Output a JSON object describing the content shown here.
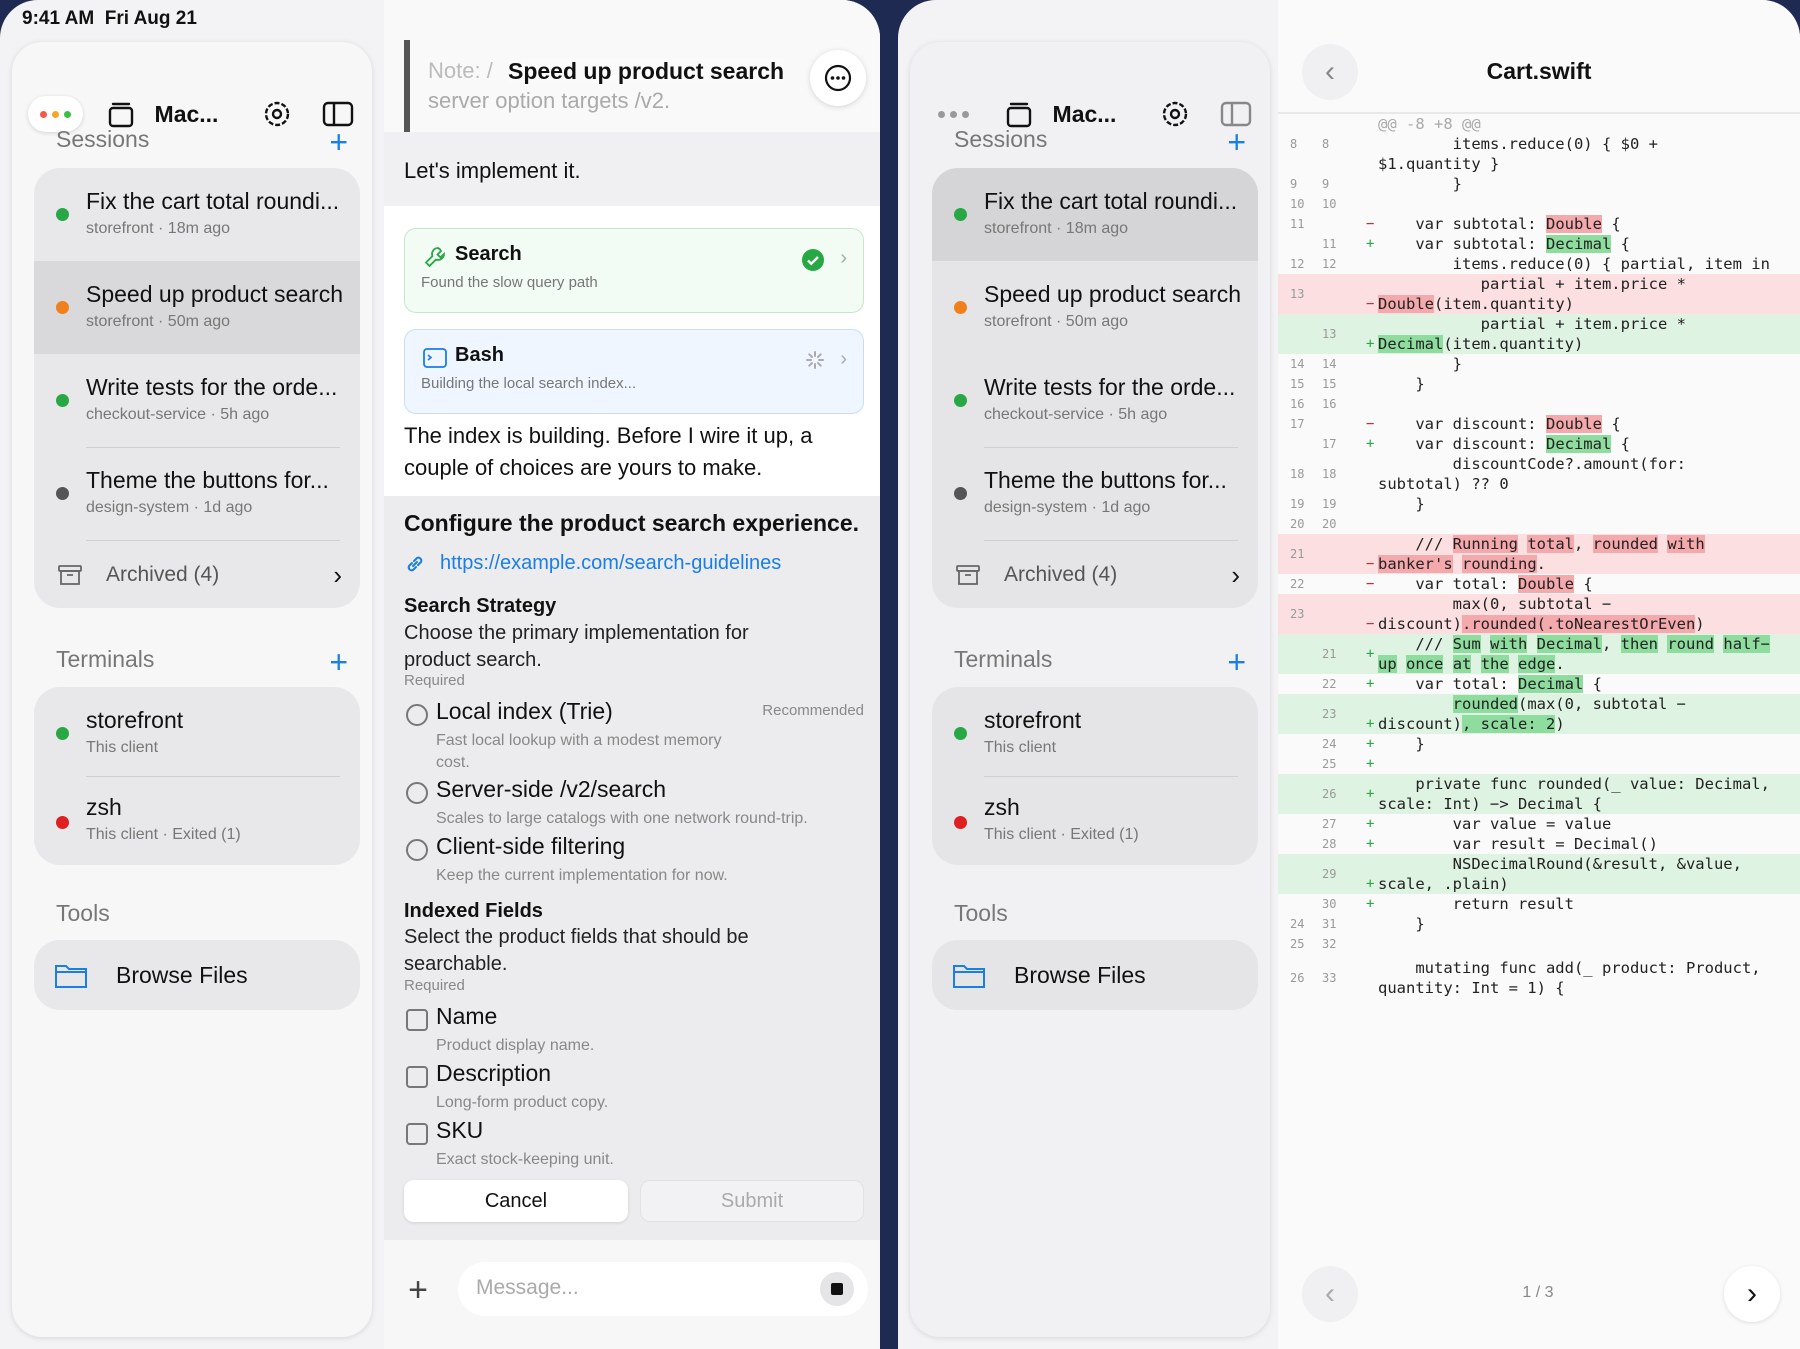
{
  "status": {
    "time": "9:41 AM",
    "date": "Fri Aug 21"
  },
  "colors": {
    "accent": "#1a7ee8",
    "green": "#28a745",
    "orange": "#f0801c",
    "red": "#e02020",
    "gray": "#555555",
    "removed": "#fce0e1",
    "added": "#dff3e3"
  },
  "sidebar": {
    "title": "Mac...",
    "sessions_label": "Sessions",
    "sessions": [
      {
        "title": "Fix the cart total roundi...",
        "sub": "storefront · 18m ago"
      },
      {
        "title": "Speed up product search",
        "sub": "storefront · 50m ago"
      },
      {
        "title": "Write tests for the orde...",
        "sub": "checkout-service · 5h ago"
      },
      {
        "title": "Theme the buttons for...",
        "sub": "design-system · 1d ago"
      }
    ],
    "archived": "Archived (4)",
    "terminals_label": "Terminals",
    "terminals": [
      {
        "title": "storefront",
        "sub": "This client"
      },
      {
        "title": "zsh",
        "sub": "This client · Exited (1)"
      }
    ],
    "tools_label": "Tools",
    "browse_files": "Browse Files"
  },
  "chat": {
    "title": "Speed up product search",
    "bg_note": "Note: / ... server option targets /v2.",
    "bg_note1": "Note: /",
    "bg_note2": "server option targets /v2.",
    "user_msg": "Let's implement it.",
    "tools": [
      {
        "name": "Search",
        "desc": "Found the slow query path"
      },
      {
        "name": "Bash",
        "desc": "Building the local search index..."
      }
    ],
    "assistant_msg": "The index is building. Before I wire it up, a couple of choices are yours to make.",
    "form": {
      "heading": "Configure the product search experience.",
      "link": "https://example.com/search-guidelines",
      "q1_label": "Search Strategy",
      "q1_desc": "Choose the primary implementation for product search.",
      "q1_required": "Required",
      "q1_options": [
        {
          "name": "Local index (Trie)",
          "desc": "Fast local lookup with a modest memory cost.",
          "badge": "Recommended"
        },
        {
          "name": "Server-side /v2/search",
          "desc": "Scales to large catalogs with one network round-trip."
        },
        {
          "name": "Client-side filtering",
          "desc": "Keep the current implementation for now."
        }
      ],
      "q2_label": "Indexed Fields",
      "q2_desc": "Select the product fields that should be searchable.",
      "q2_required": "Required",
      "q2_options": [
        {
          "name": "Name",
          "desc": "Product display name."
        },
        {
          "name": "Description",
          "desc": "Long-form product copy."
        },
        {
          "name": "SKU",
          "desc": "Exact stock-keeping unit."
        }
      ],
      "cancel": "Cancel",
      "submit": "Submit"
    },
    "composer_placeholder": "Message..."
  },
  "diff": {
    "file": "Cart.swift",
    "hunk": "@@ -8 +8 @@",
    "page": "1 / 3"
  }
}
